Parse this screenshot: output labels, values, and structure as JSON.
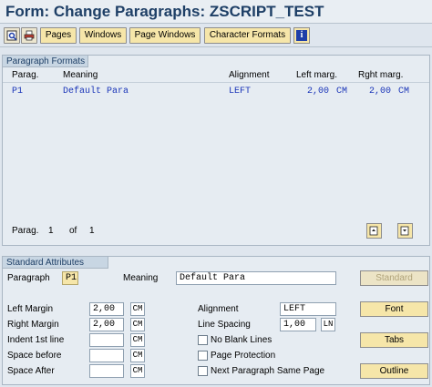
{
  "window": {
    "title": "Form: Change Paragraphs: ZSCRIPT_TEST"
  },
  "toolbar": {
    "icons": [
      "overview-icon",
      "print-icon"
    ],
    "buttons": [
      "Pages",
      "Windows",
      "Page Windows",
      "Character Formats"
    ],
    "info_icon": "i"
  },
  "paragraph_formats": {
    "header": "Paragraph Formats",
    "columns": {
      "parag": "Parag.",
      "meaning": "Meaning",
      "alignment": "Alignment",
      "left_marg": "Left marg.",
      "right_marg": "Rght marg."
    },
    "rows": [
      {
        "parag": "P1",
        "meaning": "Default Para",
        "alignment": "LEFT",
        "left_value": "2,00",
        "left_unit": "CM",
        "right_value": "2,00",
        "right_unit": "CM"
      }
    ],
    "pager": {
      "label": "Parag.",
      "current": "1",
      "of_label": "of",
      "total": "1"
    }
  },
  "standard_attributes": {
    "header": "Standard Attributes",
    "paragraph_label": "Paragraph",
    "paragraph_value": "P1",
    "meaning_label": "Meaning",
    "meaning_value": "Default Para",
    "left_margin_label": "Left Margin",
    "left_margin_value": "2,00",
    "left_margin_unit": "CM",
    "right_margin_label": "Right Margin",
    "right_margin_value": "2,00",
    "right_margin_unit": "CM",
    "indent_label": "Indent 1st line",
    "indent_value": "",
    "indent_unit": "CM",
    "space_before_label": "Space before",
    "space_before_value": "",
    "space_before_unit": "CM",
    "space_after_label": "Space After",
    "space_after_value": "",
    "space_after_unit": "CM",
    "alignment_label": "Alignment",
    "alignment_value": "LEFT",
    "line_spacing_label": "Line Spacing",
    "line_spacing_value": "1,00",
    "line_spacing_unit": "LN",
    "no_blank_lines_label": "No Blank Lines",
    "page_protection_label": "Page Protection",
    "next_same_page_label": "Next Paragraph Same Page"
  },
  "side_buttons": {
    "standard": "Standard",
    "font": "Font",
    "tabs": "Tabs",
    "outline": "Outline"
  },
  "colors": {
    "title": "#1e3f66",
    "button": "#f6e6a9",
    "panel": "#e6ecf2",
    "header": "#c8d6e3",
    "grid_text": "#1a35b8"
  }
}
